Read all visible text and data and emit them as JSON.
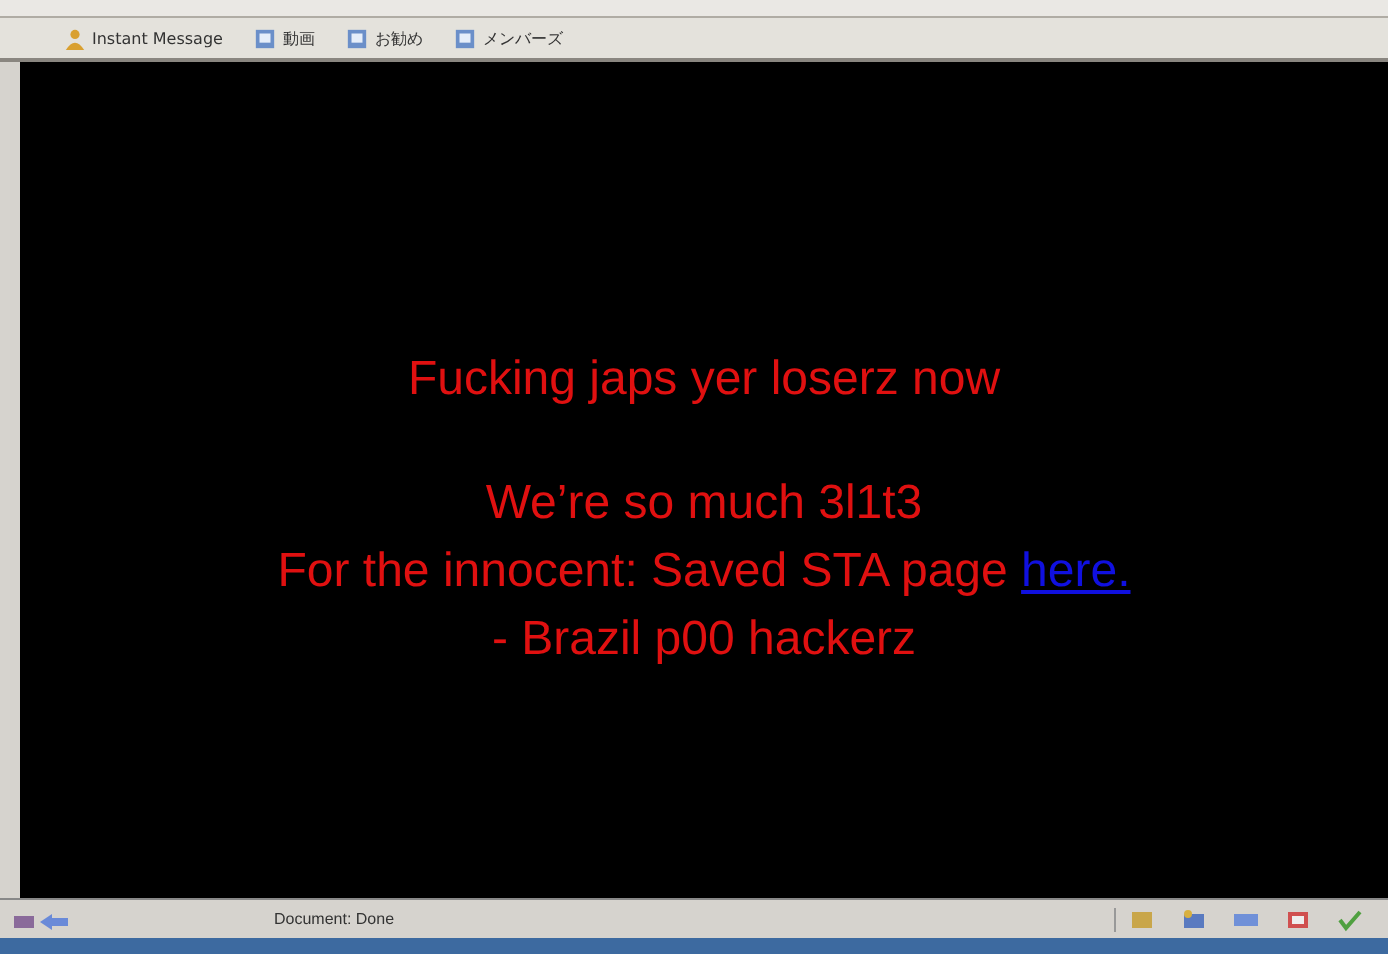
{
  "links_bar": [
    {
      "label": "Instant Message",
      "kind": "person"
    },
    {
      "label": "動画",
      "kind": "page"
    },
    {
      "label": "お勧め",
      "kind": "page"
    },
    {
      "label": "メンバーズ",
      "kind": "page"
    }
  ],
  "page": {
    "heading": "Fucking japs yer loserz now",
    "lines": [
      "We’re so much 3l1t3",
      "For the innocent: Saved STA page",
      "- Brazil p00 hackerz"
    ],
    "link": "here."
  },
  "status_bar": {
    "text": "Document: Done"
  }
}
